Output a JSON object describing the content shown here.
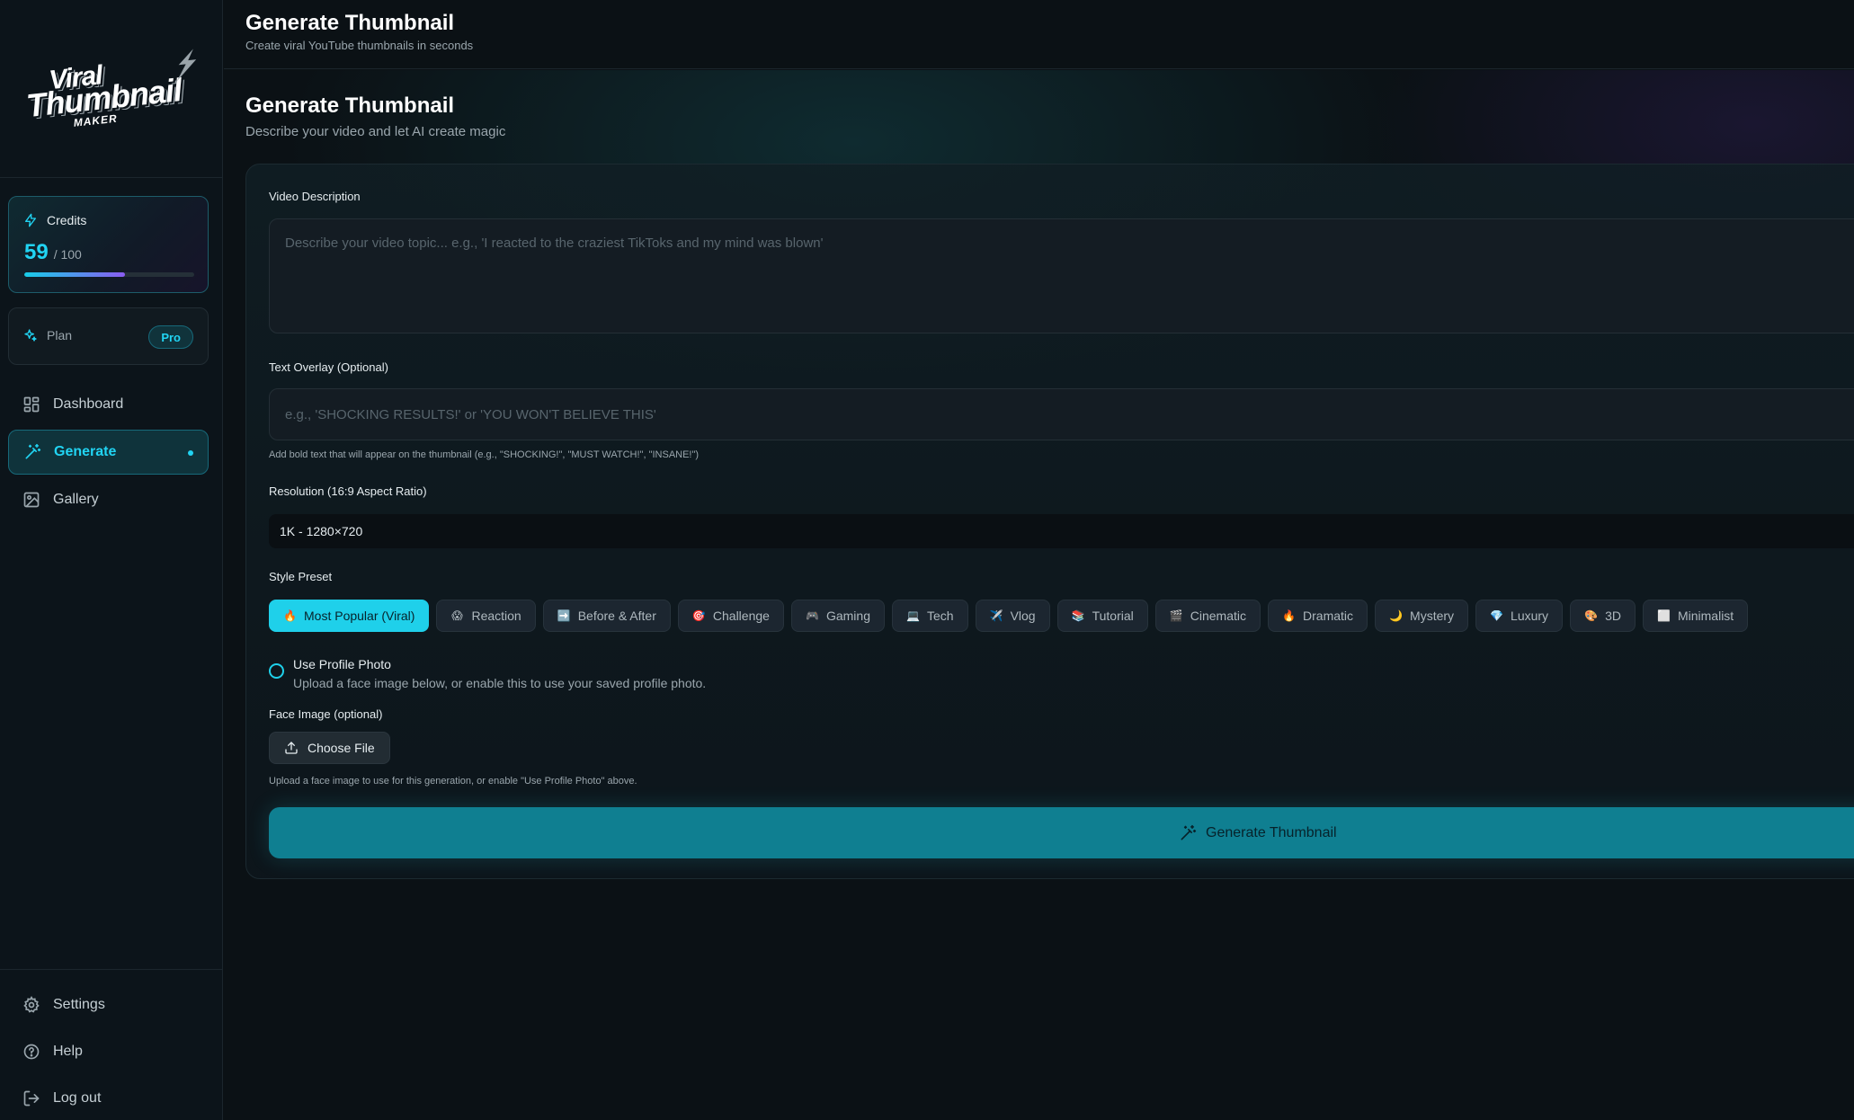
{
  "logo": {
    "line1": "Viral",
    "line2": "Thumbnail",
    "line3": "MAKER"
  },
  "credits": {
    "label": "Credits",
    "value": "59",
    "max": "/ 100",
    "fraction": 0.59
  },
  "plan": {
    "label": "Plan",
    "badge": "Pro"
  },
  "nav": [
    {
      "label": "Dashboard"
    },
    {
      "label": "Generate"
    },
    {
      "label": "Gallery"
    }
  ],
  "bottom_nav": [
    {
      "label": "Settings"
    },
    {
      "label": "Help"
    },
    {
      "label": "Log out"
    }
  ],
  "header": {
    "title": "Generate Thumbnail",
    "subtitle": "Create viral YouTube thumbnails in seconds"
  },
  "page": {
    "title": "Generate Thumbnail",
    "subtitle": "Describe your video and let AI create magic"
  },
  "form": {
    "video_label": "Video Description",
    "video_placeholder": "Describe your video topic... e.g., 'I reacted to the craziest TikToks and my mind was blown'",
    "overlay_label": "Text Overlay (Optional)",
    "overlay_placeholder": "e.g., 'SHOCKING RESULTS!' or 'YOU WON'T BELIEVE THIS'",
    "overlay_hint": "Add bold text that will appear on the thumbnail (e.g., \"SHOCKING!\", \"MUST WATCH!\", \"INSANE!\")",
    "resolution_label": "Resolution (16:9 Aspect Ratio)",
    "resolution_value": "1K - 1280×720",
    "style_label": "Style Preset",
    "presets": [
      {
        "emoji": "🔥",
        "label": "Most Popular (Viral)"
      },
      {
        "emoji": "😱",
        "label": "Reaction"
      },
      {
        "emoji": "➡️",
        "label": "Before & After"
      },
      {
        "emoji": "🎯",
        "label": "Challenge"
      },
      {
        "emoji": "🎮",
        "label": "Gaming"
      },
      {
        "emoji": "💻",
        "label": "Tech"
      },
      {
        "emoji": "✈️",
        "label": "Vlog"
      },
      {
        "emoji": "📚",
        "label": "Tutorial"
      },
      {
        "emoji": "🎬",
        "label": "Cinematic"
      },
      {
        "emoji": "🔥",
        "label": "Dramatic"
      },
      {
        "emoji": "🌙",
        "label": "Mystery"
      },
      {
        "emoji": "💎",
        "label": "Luxury"
      },
      {
        "emoji": "🎨",
        "label": "3D"
      },
      {
        "emoji": "⬜",
        "label": "Minimalist"
      }
    ],
    "profile_title": "Use Profile Photo",
    "profile_desc": "Upload a face image below, or enable this to use your saved profile photo.",
    "face_label": "Face Image (optional)",
    "file_button": "Choose File",
    "face_hint": "Upload a face image to use for this generation, or enable \"Use Profile Photo\" above.",
    "generate_button": "Generate Thumbnail"
  }
}
